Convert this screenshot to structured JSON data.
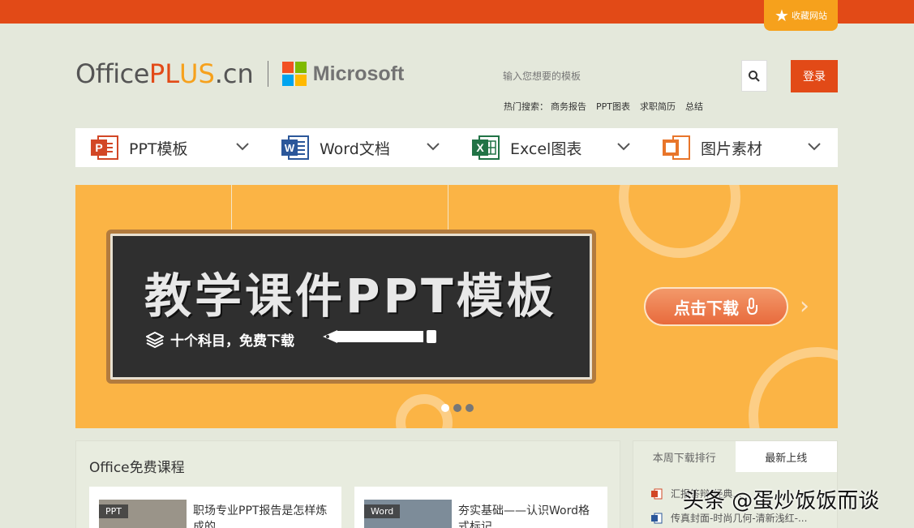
{
  "topbar": {
    "favorite_label": "收藏网站",
    "favorite_icon": "star-icon"
  },
  "brand": {
    "office": "Office",
    "plus": "PL",
    "us": "US",
    "cn": ".cn",
    "partner": "Microsoft"
  },
  "search": {
    "placeholder": "输入您想要的模板",
    "icon": "search-icon"
  },
  "login_label": "登录",
  "hot_search": {
    "label": "热门搜索：",
    "items": [
      "商务报告",
      "PPT图表",
      "求职简历",
      "总结"
    ]
  },
  "nav": [
    {
      "label": "PPT模板",
      "color": "#d24726"
    },
    {
      "label": "Word文档",
      "color": "#2b579a"
    },
    {
      "label": "Excel图表",
      "color": "#217346"
    },
    {
      "label": "图片素材",
      "color": "#e8752a"
    }
  ],
  "banner": {
    "headline": "教学课件PPT模板",
    "subline": "十个科目，免费下载",
    "cta": "点击下载",
    "next_arrow": "›",
    "slides": 3,
    "active_slide": 1
  },
  "courses": {
    "title": "Office免费课程",
    "cards": [
      {
        "tag": "PPT",
        "title": "职场专业PPT报告是怎样炼成的"
      },
      {
        "tag": "Word",
        "title": "夯实基础——认识Word格式标记"
      }
    ]
  },
  "ranking": {
    "tabs": [
      "本周下载排行",
      "最新上线"
    ],
    "active_tab": 1,
    "items": [
      {
        "type": "ppt",
        "title": "汇报答辩-经典..."
      },
      {
        "type": "word",
        "title": "传真封面-时尚几何-清新浅红-..."
      }
    ]
  },
  "watermark": "头条 @蛋炒饭饭而谈"
}
